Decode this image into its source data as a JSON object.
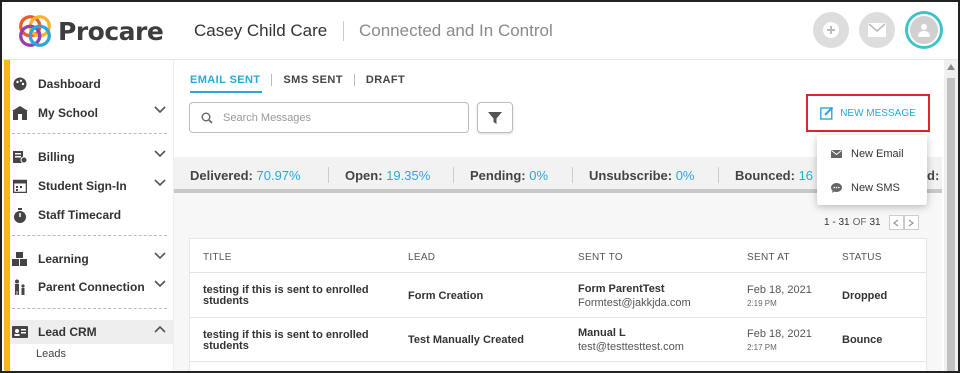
{
  "header": {
    "logo_text": "Procare",
    "center_name": "Casey Child Care",
    "tagline": "Connected and In Control",
    "add_icon": "plus-icon",
    "mail_icon": "mail-icon",
    "avatar_icon": "user-icon"
  },
  "sidebar": {
    "items": [
      {
        "label": "Dashboard",
        "icon": "palette-icon"
      },
      {
        "label": "My School",
        "icon": "school-icon"
      },
      {
        "label": "Billing",
        "icon": "billing-icon"
      },
      {
        "label": "Student Sign-In",
        "icon": "calendar-icon"
      },
      {
        "label": "Staff Timecard",
        "icon": "timer-icon"
      },
      {
        "label": "Learning",
        "icon": "blocks-icon"
      },
      {
        "label": "Parent Connection",
        "icon": "family-icon"
      },
      {
        "label": "Lead CRM",
        "icon": "id-card-icon"
      }
    ],
    "sub_item": "Leads"
  },
  "tabs": [
    "EMAIL SENT",
    "SMS SENT",
    "DRAFT"
  ],
  "search": {
    "placeholder": "Search Messages"
  },
  "new_message": {
    "label": "NEW MESSAGE",
    "menu": [
      {
        "label": "New Email",
        "icon": "envelope-icon"
      },
      {
        "label": "New SMS",
        "icon": "chat-icon"
      }
    ]
  },
  "stats": {
    "delivered_label": "Delivered:",
    "delivered_value": "70.97%",
    "open_label": "Open:",
    "open_value": "19.35%",
    "pending_label": "Pending:",
    "pending_value": "0%",
    "unsubscribe_label": "Unsubscribe:",
    "unsubscribe_value": "0%",
    "bounced_label": "Bounced:",
    "bounced_value": "16",
    "trailing": "d:"
  },
  "pager": {
    "range": "1 - 31",
    "of": "OF",
    "total": "31"
  },
  "table": {
    "headers": [
      "TITLE",
      "LEAD",
      "SENT TO",
      "SENT AT",
      "STATUS"
    ],
    "rows": [
      {
        "title_line1": "testing if this is sent to enrolled",
        "title_line2": "students",
        "lead": "Form Creation",
        "sent_to_name": "Form ParentTest",
        "sent_to_email": "Formtest@jakkjda.com",
        "sent_date": "Feb 18, 2021",
        "sent_time": "2:19 PM",
        "status": "Dropped"
      },
      {
        "title_line1": "testing if this is sent to enrolled",
        "title_line2": "students",
        "lead": "Test Manually Created",
        "sent_to_name": "Manual L",
        "sent_to_email": "test@testtesttest.com",
        "sent_date": "Feb 18, 2021",
        "sent_time": "2:17 PM",
        "status": "Bounce"
      }
    ]
  },
  "colors": {
    "accent": "#2ba8d8",
    "highlight": "#e0242b",
    "sidebar_accent": "#f4b71c"
  }
}
